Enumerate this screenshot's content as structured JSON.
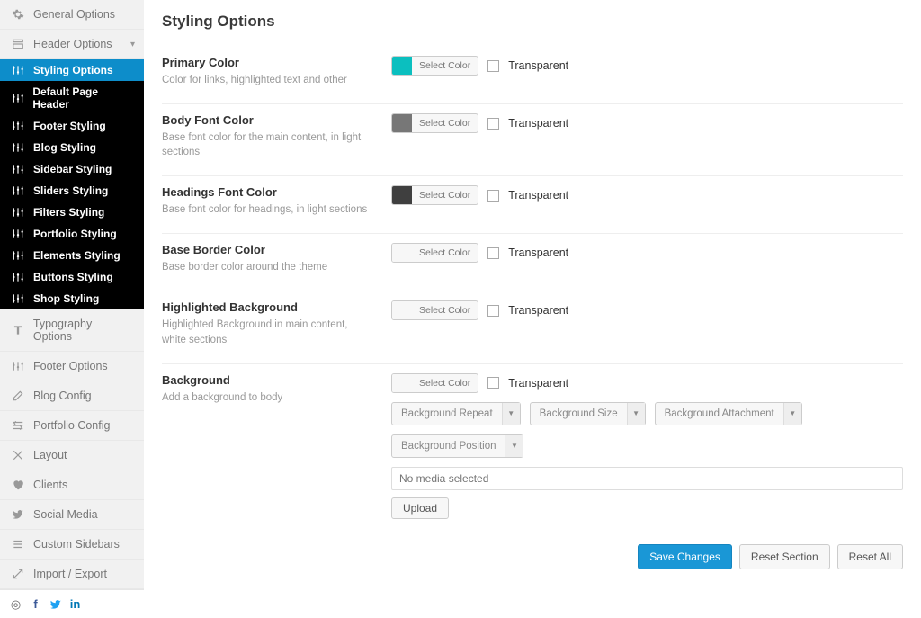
{
  "pageTitle": "Styling Options",
  "sidebar": {
    "top": [
      {
        "label": "General Options"
      },
      {
        "label": "Header Options"
      }
    ],
    "sub": [
      "Styling Options",
      "Default Page Header",
      "Footer Styling",
      "Blog Styling",
      "Sidebar Styling",
      "Sliders Styling",
      "Filters Styling",
      "Portfolio Styling",
      "Elements Styling",
      "Buttons Styling",
      "Shop Styling"
    ],
    "bottom": [
      "Typography Options",
      "Footer Options",
      "Blog Config",
      "Portfolio Config",
      "Layout",
      "Clients",
      "Social Media",
      "Custom Sidebars",
      "Import / Export"
    ]
  },
  "labels": {
    "selectColor": "Select Color",
    "transparent": "Transparent",
    "noMedia": "No media selected",
    "upload": "Upload",
    "save": "Save Changes",
    "resetSection": "Reset Section",
    "resetAll": "Reset All"
  },
  "options": [
    {
      "title": "Primary Color",
      "desc": "Color for links, highlighted text and other",
      "swatch": "teal"
    },
    {
      "title": "Body Font Color",
      "desc": "Base font color for the main content, in light sections",
      "swatch": "gray"
    },
    {
      "title": "Headings Font Color",
      "desc": "Base font color for headings, in light sections",
      "swatch": "dark"
    },
    {
      "title": "Base Border Color",
      "desc": "Base border color around the theme",
      "swatch": "none"
    },
    {
      "title": "Highlighted Background",
      "desc": "Highlighted Background in main content, white sections",
      "swatch": "none"
    }
  ],
  "background": {
    "title": "Background",
    "desc": "Add a background to body",
    "dropdowns": [
      "Background Repeat",
      "Background Size",
      "Background Attachment",
      "Background Position"
    ]
  }
}
